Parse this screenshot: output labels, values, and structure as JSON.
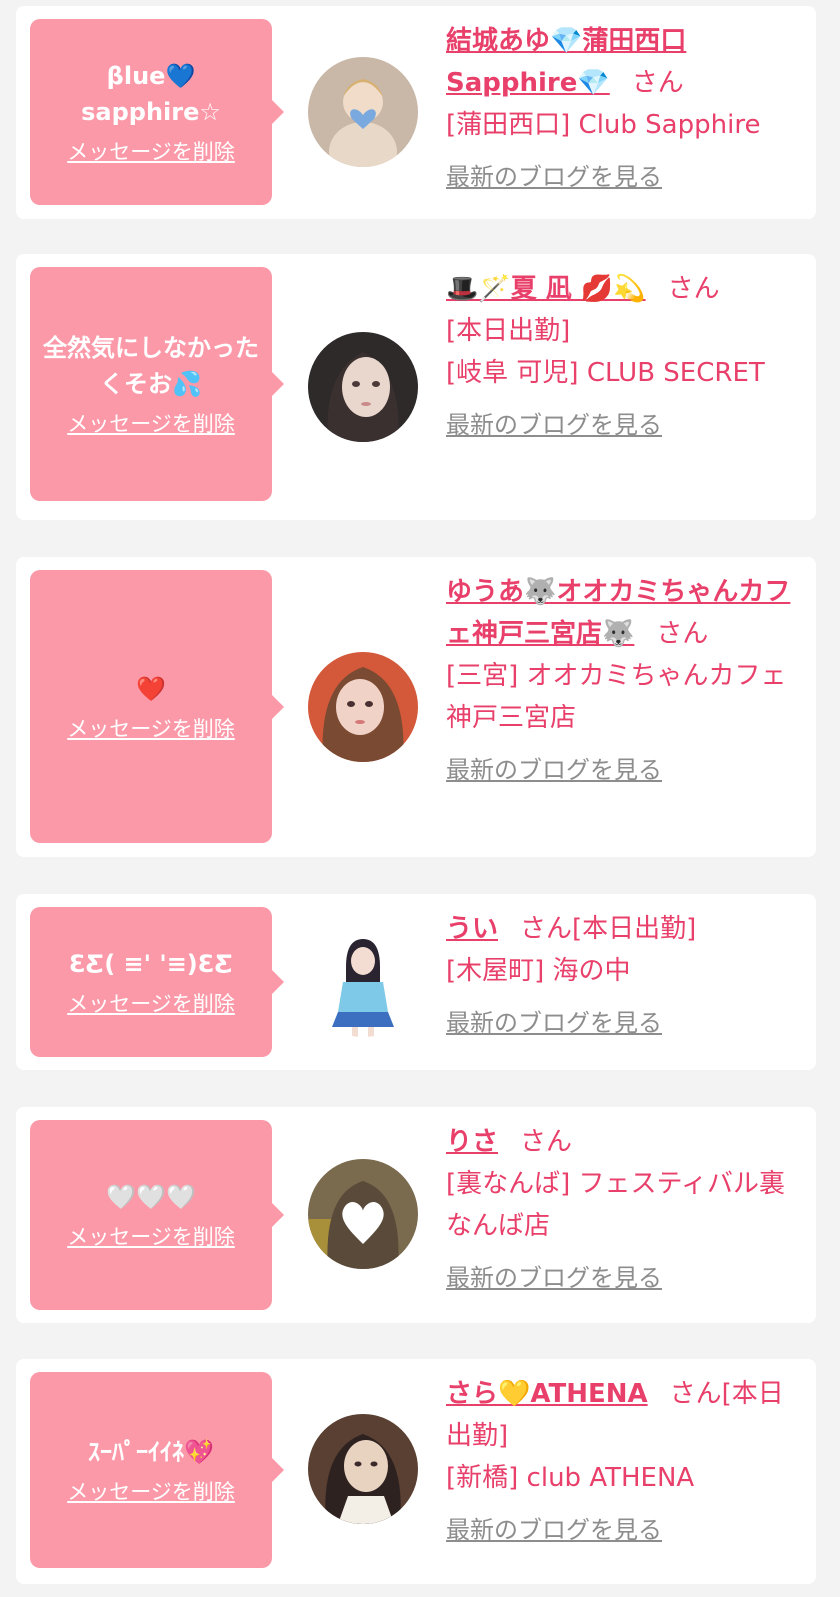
{
  "delete_label": "メッセージを削除",
  "blog_label": "最新のブログを見る",
  "san_label": "さん",
  "cards": [
    {
      "message": "βlue💙sapphire☆",
      "name": "結城あゆ💎蒲田西口Sapphire💎",
      "status": "",
      "shop": "[蒲田西口] Club Sapphire"
    },
    {
      "message": "全然気にしなかったくそお💦",
      "name": "🎩🪄夏 凪 💋💫",
      "status": "[本日出勤]",
      "shop": "[岐阜 可児] CLUB SECRET"
    },
    {
      "message": "❤️",
      "name": "ゆうあ🐺オオカミちゃんカフェ神戸三宮店🐺",
      "status": "",
      "shop": "[三宮] オオカミちゃんカフェ神戸三宮店"
    },
    {
      "message": "ƐƸ( ≡' '≡)ƐƸ",
      "name": "うい",
      "status": "[本日出勤]",
      "shop": "[木屋町] 海の中"
    },
    {
      "message": "🤍🤍🤍",
      "name": "りさ",
      "status": "",
      "shop": "[裏なんば] フェスティバル裏なんば店"
    },
    {
      "message": "ｽｰﾊﾟｰｲｲﾈ💖",
      "name": "さら💛ATHENA",
      "status": "[本日出勤]",
      "shop": "[新橋] club ATHENA"
    }
  ],
  "avatars": [
    {
      "icon": "avatar-photo-1",
      "bg": "#c9b8a8",
      "fg": "#7aa9e0"
    },
    {
      "icon": "avatar-photo-2",
      "bg": "#2e2a2a",
      "fg": "#e9d6cc"
    },
    {
      "icon": "avatar-photo-3",
      "bg": "#d4583a",
      "fg": "#f1d2c6"
    },
    {
      "icon": "avatar-photo-4",
      "bg": "#ffffff",
      "fg": "#3c6fbf"
    },
    {
      "icon": "avatar-photo-5",
      "bg": "#7a6a4e",
      "fg": "#ffffff"
    },
    {
      "icon": "avatar-photo-6",
      "bg": "#5a4032",
      "fg": "#e8d2c0"
    }
  ],
  "colors": {
    "accent": "#e8406a",
    "bubble": "#fc99a8",
    "muted": "#8d8d8d",
    "background": "#f3f3f3"
  }
}
